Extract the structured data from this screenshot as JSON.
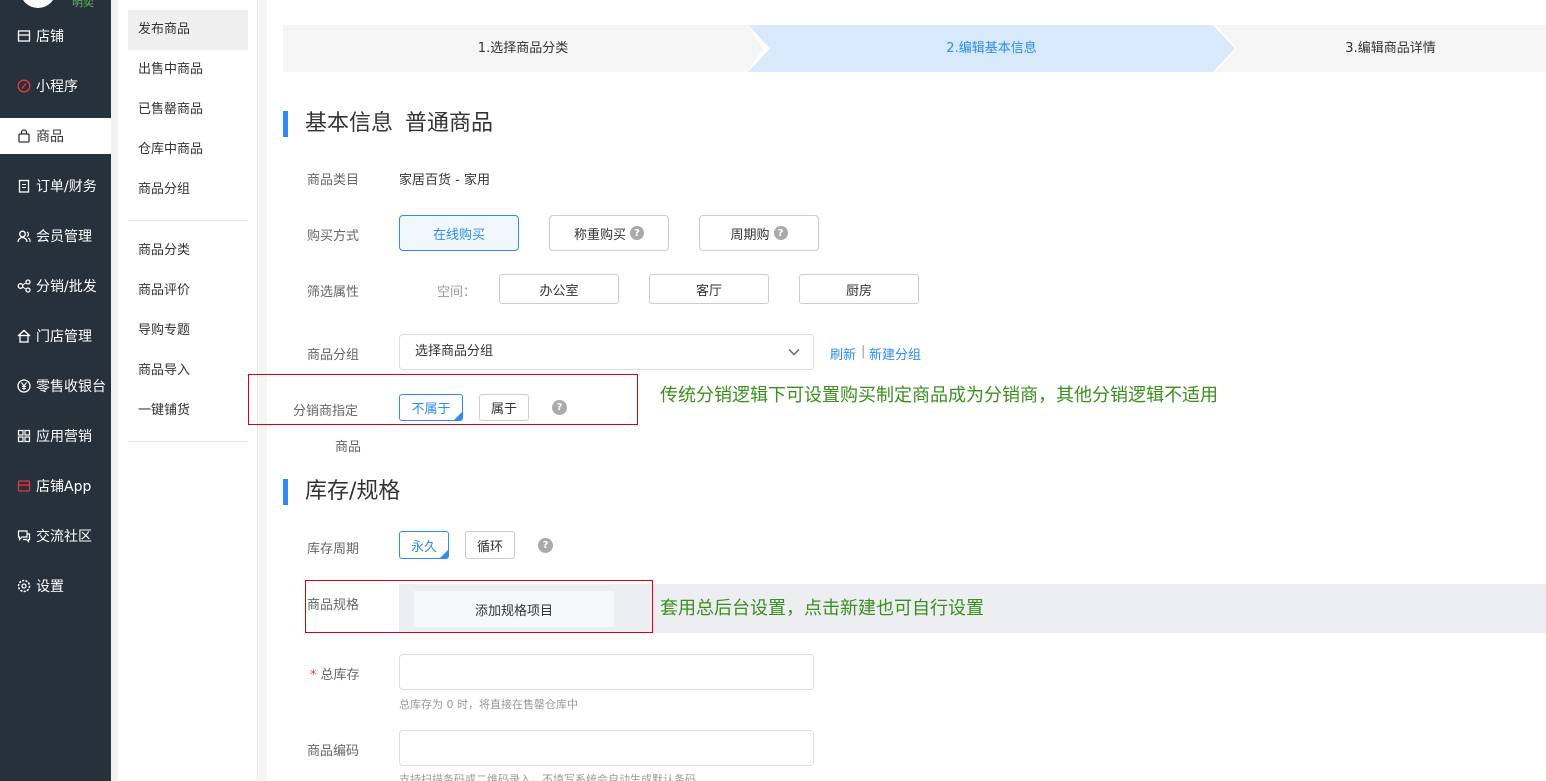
{
  "sidebar": {
    "logo_tag": "明奕",
    "items": [
      {
        "label": "店铺",
        "icon": "store-icon"
      },
      {
        "label": "小程序",
        "icon": "miniprogram-icon"
      },
      {
        "label": "商品",
        "icon": "bag-icon"
      },
      {
        "label": "订单/财务",
        "icon": "clipboard-icon"
      },
      {
        "label": "会员管理",
        "icon": "members-icon"
      },
      {
        "label": "分销/批发",
        "icon": "share-icon"
      },
      {
        "label": "门店管理",
        "icon": "home-icon"
      },
      {
        "label": "零售收银台",
        "icon": "yen-icon"
      },
      {
        "label": "应用营销",
        "icon": "apps-icon"
      },
      {
        "label": "店铺App",
        "icon": "app-store-icon"
      },
      {
        "label": "交流社区",
        "icon": "chat-icon"
      },
      {
        "label": "设置",
        "icon": "gear-icon"
      }
    ],
    "active": "商品"
  },
  "subnav": {
    "items": [
      "发布商品",
      "出售中商品",
      "已售罄商品",
      "仓库中商品",
      "商品分组",
      "商品分类",
      "商品评价",
      "导购专题",
      "商品导入",
      "一键铺货"
    ],
    "active": "发布商品"
  },
  "steps": [
    "1.选择商品分类",
    "2.编辑基本信息",
    "3.编辑商品详情"
  ],
  "basic": {
    "title": "基本信息",
    "subtitle": "普通商品",
    "category_label": "商品类目",
    "category_value": "家居百货 - 家用",
    "buy_label": "购买方式",
    "buy_options": [
      "在线购买",
      "称重购买",
      "周期购"
    ],
    "filter_label": "筛选属性",
    "space_label": "空间：",
    "space_options": [
      "办公室",
      "客厅",
      "厨房"
    ],
    "group_label": "商品分组",
    "group_placeholder": "选择商品分组",
    "refresh": "刷新",
    "separator": "|",
    "new_group": "新建分组",
    "dist_label": "分销商指定",
    "dist_label2": "商品",
    "dist_options": [
      "不属于",
      "属于"
    ],
    "dist_note": "传统分销逻辑下可设置购买制定商品成为分销商，其他分销逻辑不适用"
  },
  "stock": {
    "title": "库存/规格",
    "period_label": "库存周期",
    "period_options": [
      "永久",
      "循环"
    ],
    "spec_label": "商品规格",
    "spec_button": "添加规格项目",
    "spec_note": "套用总后台设置，点击新建也可自行设置",
    "total_required": "*",
    "total_label": "总库存",
    "total_hint": "总库存为 0 时，将直接在售罄仓库中",
    "code_label": "商品编码",
    "code_hint": "支持扫描条码或二维码录入，不填写系统会自动生成默认条码"
  },
  "help_glyph": "?",
  "colors": {
    "accent": "#2d8cf0",
    "sidebar": "#27313c",
    "annotation": "#3a8f1d",
    "highlight_box": "#d9000d"
  }
}
